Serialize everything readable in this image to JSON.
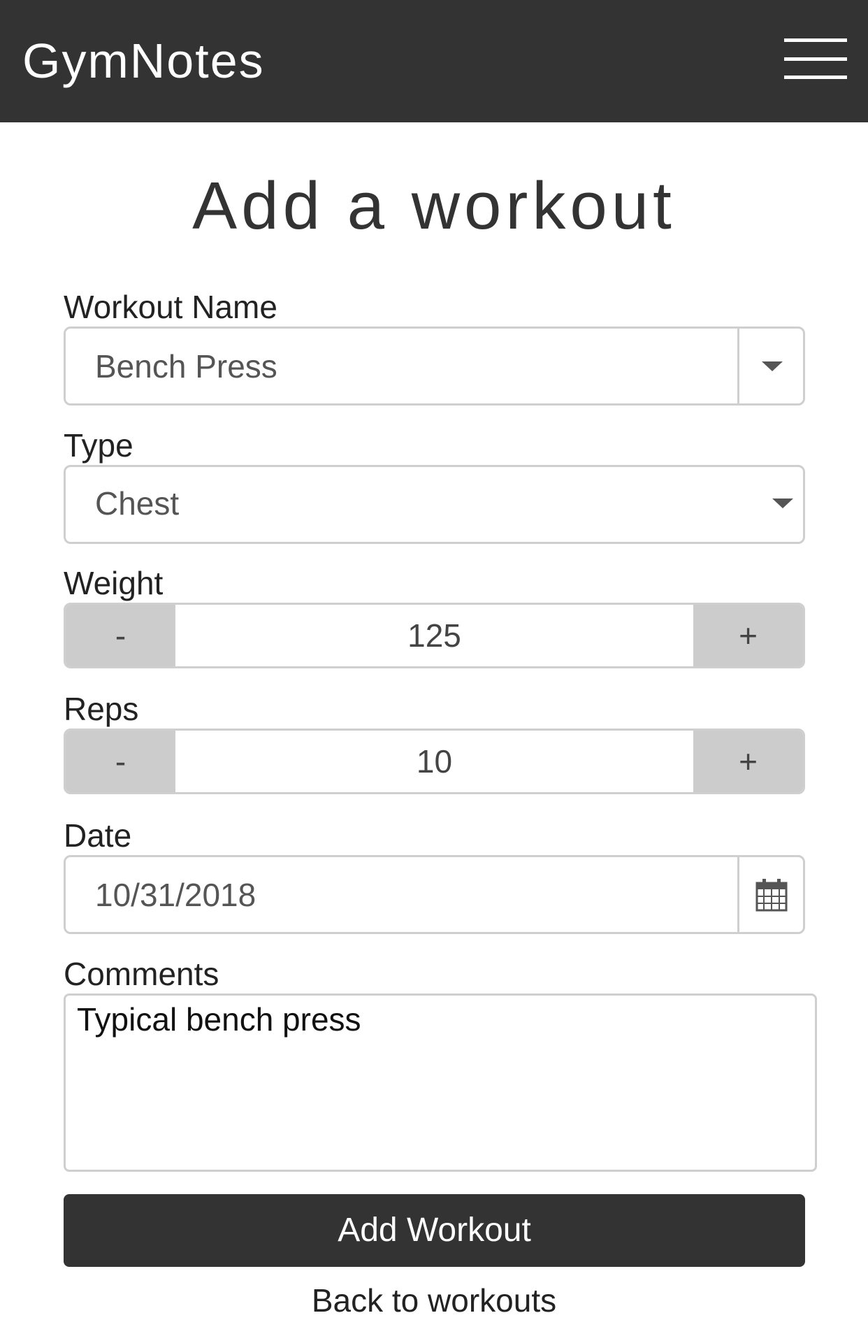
{
  "navbar": {
    "brand": "GymNotes",
    "menu_icon": "hamburger-menu-icon"
  },
  "page": {
    "title": "Add a workout"
  },
  "form": {
    "workout_name": {
      "label": "Workout Name",
      "value": "Bench Press",
      "icon": "caret-down-icon"
    },
    "type": {
      "label": "Type",
      "value": "Chest",
      "icon": "caret-down-icon"
    },
    "weight": {
      "label": "Weight",
      "decrement_label": "-",
      "value": "125",
      "increment_label": "+"
    },
    "reps": {
      "label": "Reps",
      "decrement_label": "-",
      "value": "10",
      "increment_label": "+"
    },
    "date": {
      "label": "Date",
      "value": "10/31/2018",
      "icon": "calendar-icon"
    },
    "comments": {
      "label": "Comments",
      "value": "Typical bench press"
    },
    "submit_label": "Add Workout"
  },
  "footer": {
    "back_link": "Back to workouts"
  },
  "colors": {
    "navbar_bg": "#333333",
    "button_bg": "#333333",
    "stepper_button_bg": "#cccccc",
    "border": "#cfcfcf"
  }
}
